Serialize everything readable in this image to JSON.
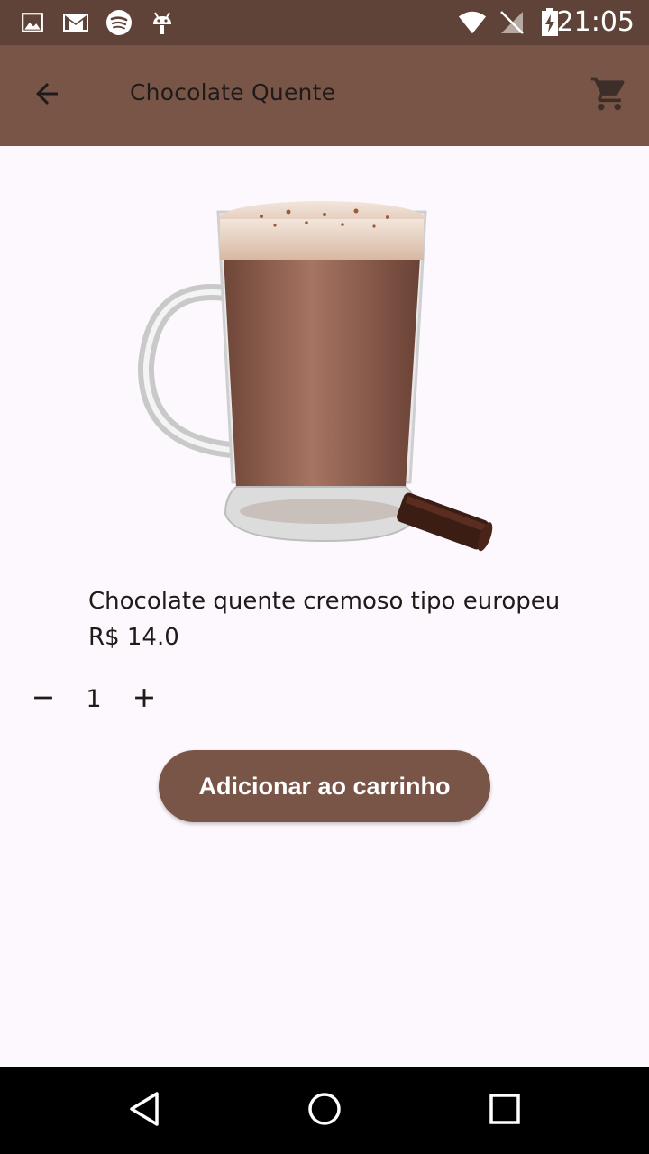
{
  "status_bar": {
    "time": "21:05",
    "icons": [
      "gallery-icon",
      "gmail-icon",
      "spotify-icon",
      "android-icon",
      "wifi-icon",
      "no-signal-icon",
      "battery-charging-icon"
    ]
  },
  "app_bar": {
    "title": "Chocolate Quente",
    "back_icon": "arrow-back-icon",
    "cart_icon": "shopping-cart-icon"
  },
  "product": {
    "name": "Chocolate quente cremoso tipo europeu",
    "price": "R$ 14.0",
    "image": "hot-chocolate-mug-image"
  },
  "quantity": {
    "value": "1",
    "minus_icon": "remove-icon",
    "plus_icon": "add-icon"
  },
  "add_button": {
    "label": "Adicionar ao carrinho"
  },
  "nav_bar": {
    "icons": [
      "back-triangle-icon",
      "home-circle-icon",
      "recents-square-icon"
    ]
  },
  "colors": {
    "status_bar": "#5f4339",
    "app_bar": "#795548",
    "background": "#fdf8fd",
    "button": "#795548"
  }
}
